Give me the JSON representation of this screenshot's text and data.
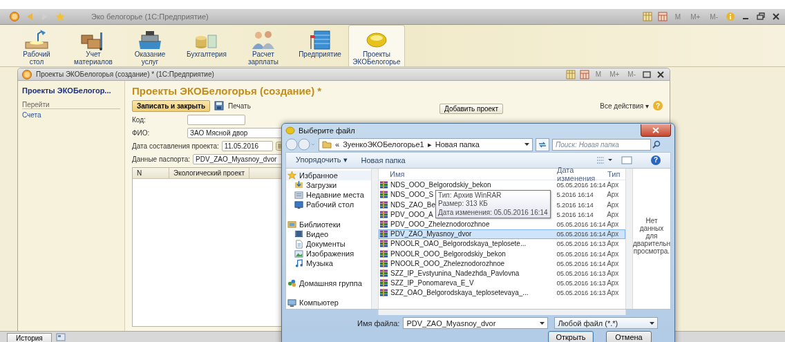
{
  "app_window": {
    "title": "Эко белогорье  (1С:Предприятие)",
    "buttons": [
      {
        "label": "M",
        "disabled": true
      },
      {
        "label": "M+",
        "disabled": true
      },
      {
        "label": "M-",
        "disabled": true
      }
    ]
  },
  "sections": [
    {
      "label": "Рабочий\nстол",
      "kind": "desk",
      "selected": false
    },
    {
      "label": "Учет\nматериалов",
      "kind": "boxes",
      "selected": false
    },
    {
      "label": "Оказание\nуслуг",
      "kind": "register",
      "selected": false
    },
    {
      "label": "Бухгалтерия",
      "kind": "coins",
      "selected": false
    },
    {
      "label": "Расчет\nзарплаты",
      "kind": "people",
      "selected": false
    },
    {
      "label": "Предприятие",
      "kind": "building",
      "selected": false
    },
    {
      "label": "Проекты\nЭКОБелогорье",
      "kind": "orb",
      "selected": true
    }
  ],
  "form_window": {
    "title": "Проекты ЭКОБелогорья (создание) *  (1С:Предприятие)",
    "buttons": [
      {
        "label": "M",
        "disabled": true
      },
      {
        "label": "M+",
        "disabled": true
      },
      {
        "label": "M-",
        "disabled": true
      }
    ],
    "nav": {
      "title": "Проекты ЭКОБелогор...",
      "section": "Перейти",
      "items": [
        "Счета"
      ]
    },
    "heading": "Проекты ЭКОБелогорья (создание) *",
    "toolbar": {
      "primary": "Записать и закрыть",
      "print": "Печать",
      "all_actions": "Все действия ▾",
      "help": "?"
    },
    "fields": [
      {
        "label": "Код:",
        "kind": "text"
      },
      {
        "label": "ФИО:",
        "kind": "text",
        "value": "ЗАО Мясной двор"
      },
      {
        "label": "Дата составления проекта:",
        "kind": "date",
        "value": "11.05.2016"
      },
      {
        "label": "Данные паспорта:",
        "kind": "text",
        "value": "PDV_ZAO_Myasnoy_dvor"
      }
    ],
    "add_button": "Добавить проект",
    "table": {
      "columns": [
        "N",
        "Экологический проект"
      ]
    }
  },
  "file_dialog": {
    "title": "Выберите файл",
    "address": [
      "«",
      "ЗуенкоЭКОБелогорье1",
      "▸",
      "Новая папка"
    ],
    "search": {
      "placeholder": "Поиск: Новая папка"
    },
    "toolbar": {
      "organize": "Упорядочить ▾",
      "new_folder": "Новая папка",
      "help": "?"
    },
    "nav": [
      {
        "label": "Избранное",
        "kind": "group"
      },
      {
        "label": "Загрузки",
        "kind": "item"
      },
      {
        "label": "Недавние места",
        "kind": "item"
      },
      {
        "label": "Рабочий стол",
        "kind": "item"
      },
      {
        "kind": "gap"
      },
      {
        "label": "Библиотеки",
        "kind": "group"
      },
      {
        "label": "Видео",
        "kind": "item"
      },
      {
        "label": "Документы",
        "kind": "item"
      },
      {
        "label": "Изображения",
        "kind": "item"
      },
      {
        "label": "Музыка",
        "kind": "item"
      },
      {
        "kind": "gap"
      },
      {
        "label": "Домашняя группа",
        "kind": "group"
      },
      {
        "kind": "gap"
      },
      {
        "label": "Компьютер",
        "kind": "group"
      }
    ],
    "columns": [
      "Имя",
      "Дата изменения",
      "Тип"
    ],
    "files": [
      {
        "name": "NDS_OOO_Belgorodskiy_bekon",
        "date": "05.05.2016 16:14",
        "type": "Арх",
        "selected": false
      },
      {
        "name": "NDS_OOO_S",
        "date": "5.2016 16:14",
        "type": "Арх",
        "selected": false
      },
      {
        "name": "NDS_ZAO_Be",
        "date": "5.2016 16:14",
        "type": "Арх",
        "selected": false
      },
      {
        "name": "PDV_OOO_A",
        "date": "5.2016 16:14",
        "type": "Арх",
        "selected": false
      },
      {
        "name": "PDV_OOO_Zheleznodorozhnoe",
        "date": "05.05.2016 16:14",
        "type": "Арх",
        "selected": false
      },
      {
        "name": "PDV_ZAO_Myasnoy_dvor",
        "date": "05.05.2016 16:14",
        "type": "Арх",
        "selected": true
      },
      {
        "name": "PNOOLR_OAO_Belgorodskaya_teplosete...",
        "date": "05.05.2016 16:13",
        "type": "Арх",
        "selected": false
      },
      {
        "name": "PNOOLR_OOO_Belgorodskiy_bekon",
        "date": "05.05.2016 16:14",
        "type": "Арх",
        "selected": false
      },
      {
        "name": "PNOOLR_OOO_Zheleznodorozhnoe",
        "date": "05.05.2016 16:14",
        "type": "Арх",
        "selected": false
      },
      {
        "name": "SZZ_IP_Evstyunina_Nadezhda_Pavlovna",
        "date": "05.05.2016 16:13",
        "type": "Арх",
        "selected": false
      },
      {
        "name": "SZZ_IP_Ponomareva_E_V",
        "date": "05.05.2016 16:13",
        "type": "Арх",
        "selected": false
      },
      {
        "name": "SZZ_OAO_Belgorodskaya_teplosetevaya_...",
        "date": "05.05.2016 16:13",
        "type": "Арх",
        "selected": false
      }
    ],
    "tooltip": [
      "Тип: Архив WinRAR",
      "Размер: 313 КБ",
      "Дата изменения: 05.05.2016 16:14"
    ],
    "preview": [
      "Нет данных",
      "для",
      "дварительн",
      "просмотра."
    ],
    "filename": {
      "label": "Имя файла:",
      "value": "PDV_ZAO_Myasnoy_dvor"
    },
    "filter": "Любой файл (*.*)",
    "buttons": [
      "Открыть",
      "Отмена"
    ]
  },
  "status_bar": {
    "history_button": "История"
  }
}
